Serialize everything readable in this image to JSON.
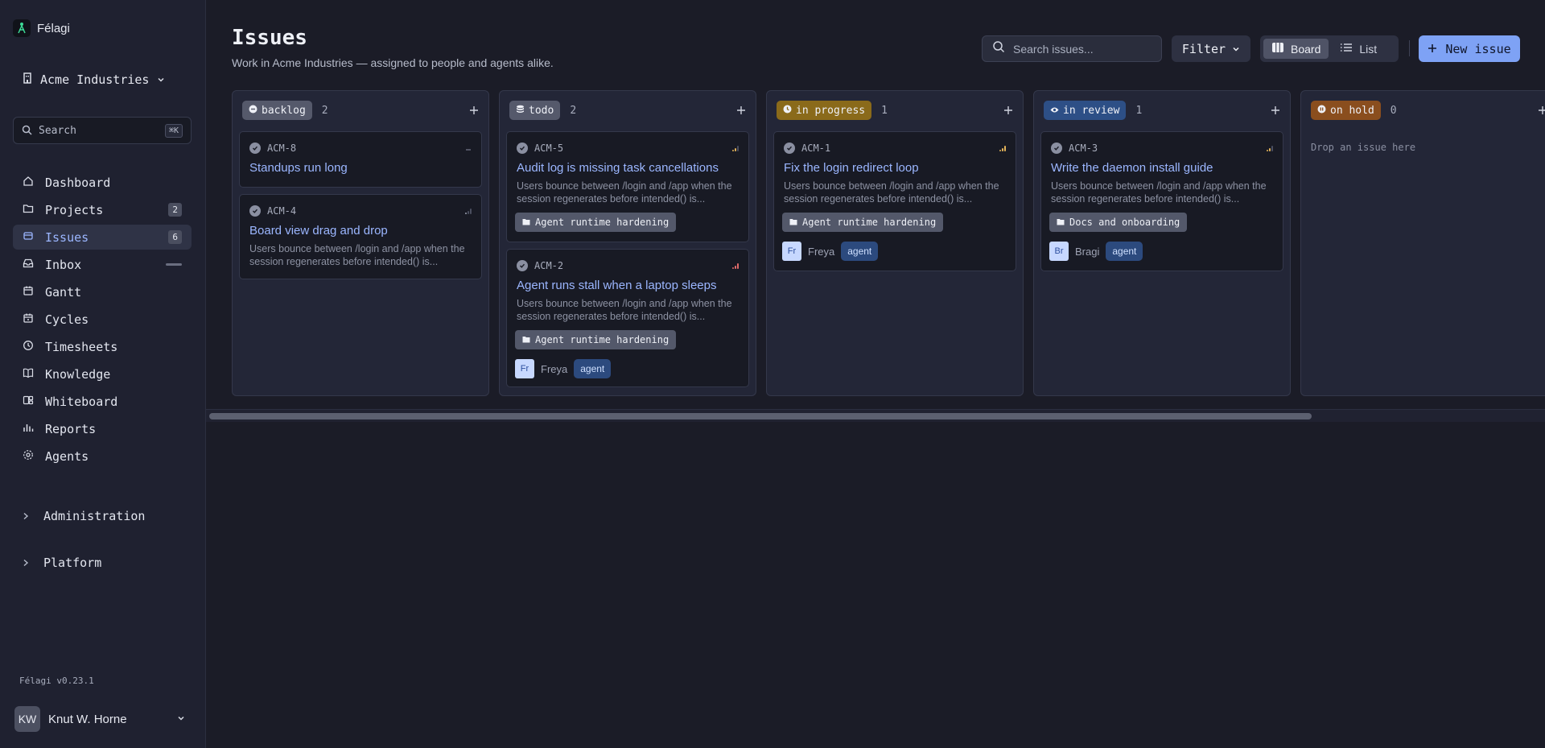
{
  "brand": {
    "name": "Félagi",
    "icon": "felagi-logo-icon"
  },
  "workspace": {
    "name": "Acme Industries"
  },
  "sidebar_search": {
    "label": "Search",
    "shortcut": "⌘K"
  },
  "nav": [
    {
      "label": "Dashboard",
      "icon": "home-icon",
      "badge": ""
    },
    {
      "label": "Projects",
      "icon": "folder-icon",
      "badge": "2"
    },
    {
      "label": "Issues",
      "icon": "stack-icon",
      "badge": "6",
      "active": true
    },
    {
      "label": "Inbox",
      "icon": "inbox-icon",
      "badge": ""
    },
    {
      "label": "Gantt",
      "icon": "calendar-icon",
      "badge": ""
    },
    {
      "label": "Cycles",
      "icon": "cycle-icon",
      "badge": ""
    },
    {
      "label": "Timesheets",
      "icon": "clock-icon",
      "badge": ""
    },
    {
      "label": "Knowledge",
      "icon": "book-icon",
      "badge": ""
    },
    {
      "label": "Whiteboard",
      "icon": "whiteboard-icon",
      "badge": ""
    },
    {
      "label": "Reports",
      "icon": "bar-chart-icon",
      "badge": ""
    },
    {
      "label": "Agents",
      "icon": "agents-icon",
      "badge": ""
    }
  ],
  "sections": {
    "administration": "Administration",
    "platform": "Platform"
  },
  "version": "Félagi v0.23.1",
  "user": {
    "initials": "KW",
    "name": "Knut W. Horne"
  },
  "header": {
    "title": "Issues",
    "subtitle": "Work in Acme Industries — assigned to people and agents alike.",
    "search_placeholder": "Search issues...",
    "filter_label": "Filter",
    "view_board": "Board",
    "view_list": "List",
    "new_issue": "New issue"
  },
  "colors": {
    "accent": "#7ea2f5",
    "backlog": "#55596b",
    "todo": "#55596b",
    "in_progress": "#8a6a1a",
    "in_review": "#2d4f86",
    "on_hold": "#8a4e1e",
    "priority_medium": "#e3b35a",
    "priority_urgent": "#e06a6a"
  },
  "columns": [
    {
      "status": "backlog",
      "count": "2",
      "cards": [
        {
          "id": "ACM-8",
          "title": "Standups run long",
          "desc": "",
          "project": "",
          "assignee": null,
          "priority": "none"
        },
        {
          "id": "ACM-4",
          "title": "Board view drag and drop",
          "desc": "Users bounce between /login and /app when the session regenerates before intended() is...",
          "project": "",
          "assignee": null,
          "priority": "low"
        }
      ]
    },
    {
      "status": "todo",
      "count": "2",
      "cards": [
        {
          "id": "ACM-5",
          "title": "Audit log is missing task cancellations",
          "desc": "Users bounce between /login and /app when the session regenerates before intended() is...",
          "project": "Agent runtime hardening",
          "assignee": null,
          "priority": "medium"
        },
        {
          "id": "ACM-2",
          "title": "Agent runs stall when a laptop sleeps",
          "desc": "Users bounce between /login and /app when the session regenerates before intended() is...",
          "project": "Agent runtime hardening",
          "assignee": {
            "initials": "Fr",
            "name": "Freya",
            "tag": "agent"
          },
          "priority": "urgent"
        }
      ]
    },
    {
      "status": "in progress",
      "count": "1",
      "cards": [
        {
          "id": "ACM-1",
          "title": "Fix the login redirect loop",
          "desc": "Users bounce between /login and /app when the session regenerates before intended() is...",
          "project": "Agent runtime hardening",
          "assignee": {
            "initials": "Fr",
            "name": "Freya",
            "tag": "agent"
          },
          "priority": "high"
        }
      ]
    },
    {
      "status": "in review",
      "count": "1",
      "cards": [
        {
          "id": "ACM-3",
          "title": "Write the daemon install guide",
          "desc": "Users bounce between /login and /app when the session regenerates before intended() is...",
          "project": "Docs and onboarding",
          "assignee": {
            "initials": "Br",
            "name": "Bragi",
            "tag": "agent"
          },
          "priority": "medium"
        }
      ]
    },
    {
      "status": "on hold",
      "count": "0",
      "drop_hint": "Drop an issue here",
      "cards": []
    }
  ]
}
